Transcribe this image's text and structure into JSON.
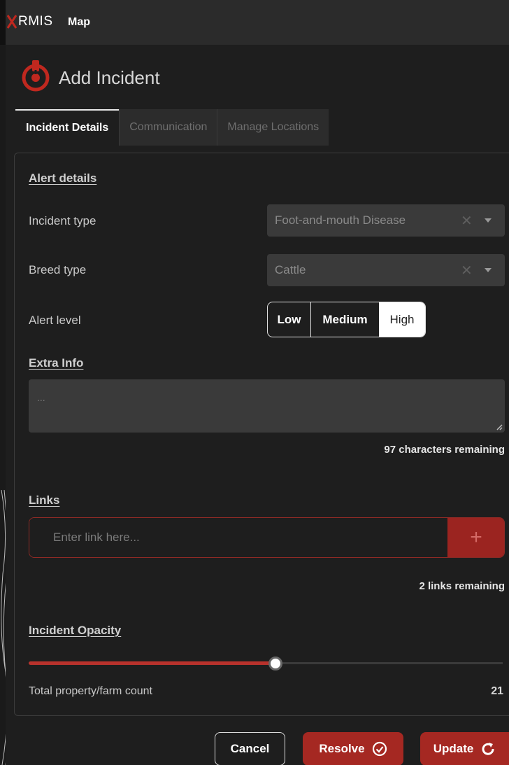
{
  "topbar": {
    "logo_text": "RMIS",
    "title": "Map"
  },
  "header": {
    "title": "Add Incident",
    "icon": "alert-radio-icon"
  },
  "tabs": [
    {
      "label": "Incident Details",
      "active": true
    },
    {
      "label": "Communication",
      "active": false
    },
    {
      "label": "Manage Locations",
      "active": false
    }
  ],
  "alert_details": {
    "section_title": "Alert details",
    "incident_type": {
      "label": "Incident type",
      "value": "Foot-and-mouth Disease"
    },
    "breed_type": {
      "label": "Breed type",
      "value": "Cattle"
    },
    "alert_level": {
      "label": "Alert level",
      "options": [
        "Low",
        "Medium",
        "High"
      ],
      "selected": "High"
    }
  },
  "extra_info": {
    "section_title": "Extra Info",
    "placeholder": "...",
    "remaining": "97 characters remaining"
  },
  "links": {
    "section_title": "Links",
    "placeholder": "Enter link here...",
    "add_symbol": "+",
    "remaining": "2 links remaining"
  },
  "opacity": {
    "section_title": "Incident Opacity",
    "value_fraction": 0.52
  },
  "farm_count": {
    "label": "Total property/farm count",
    "value": "21"
  },
  "buttons": {
    "cancel": "Cancel",
    "resolve": "Resolve",
    "update": "Update"
  },
  "colors": {
    "accent": "#a52822",
    "background": "#1e1e1e",
    "topbar": "#2b2b2b"
  }
}
